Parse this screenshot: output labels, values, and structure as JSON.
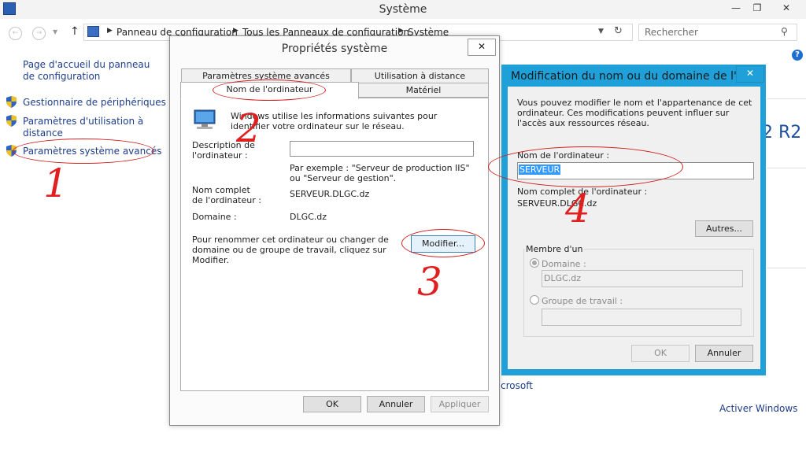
{
  "window": {
    "title": "Système",
    "minimize": "—",
    "restore": "❐",
    "close": "✕"
  },
  "nav": {
    "back": "←",
    "forward": "→",
    "up": "↑",
    "crumbs": [
      "Panneau de configuration",
      "Tous les Panneaux de configuration",
      "Système"
    ],
    "search_placeholder": "Rechercher"
  },
  "sidebar": {
    "home_link": "Page d'accueil du panneau de configuration",
    "items": [
      {
        "label": "Gestionnaire de périphériques"
      },
      {
        "label": "Paramètres d'utilisation à distance"
      },
      {
        "label": "Paramètres système avancés"
      }
    ]
  },
  "background": {
    "edition_fragment": "2 R2",
    "microsoft_fragment": "crosoft",
    "activate": "Activer Windows"
  },
  "dialog1": {
    "title": "Propriétés système",
    "close": "✕",
    "tabs": [
      "Paramètres système avancés",
      "Utilisation à distance",
      "Nom de l'ordinateur",
      "Matériel"
    ],
    "intro": "Windows utilise les informations suivantes pour identifier votre ordinateur sur le réseau.",
    "description_label": "Description de l'ordinateur :",
    "description_value": "",
    "example": "Par exemple : \"Serveur de production IIS\" ou \"Serveur de gestion\".",
    "fullname_label": "Nom complet de l'ordinateur :",
    "fullname_value": "SERVEUR.DLGC.dz",
    "domain_label": "Domaine :",
    "domain_value": "DLGC.dz",
    "rename_text": "Pour renommer cet ordinateur ou changer de domaine ou de groupe de travail, cliquez sur Modifier.",
    "modify_button": "Modifier...",
    "ok": "OK",
    "cancel": "Annuler",
    "apply": "Appliquer"
  },
  "dialog2": {
    "title": "Modification du nom ou du domaine de l'...",
    "close": "✕",
    "intro": "Vous pouvez modifier le nom et l'appartenance de cet ordinateur. Ces modifications peuvent influer sur l'accès aux ressources réseau.",
    "computer_name_label": "Nom de l'ordinateur :",
    "computer_name_value": "SERVEUR",
    "fullname_label": "Nom complet de l'ordinateur :",
    "fullname_value": "SERVEUR.DLGC.dz",
    "others_button": "Autres...",
    "member_of": "Membre d'un",
    "domain_radio": "Domaine :",
    "domain_value": "DLGC.dz",
    "workgroup_radio": "Groupe de travail :",
    "workgroup_value": "",
    "ok": "OK",
    "cancel": "Annuler"
  },
  "annotations": [
    "1",
    "2",
    "3",
    "4"
  ],
  "colors": {
    "accent_title": "#1fa0d9",
    "annotation_red": "#e02020",
    "link_blue": "#1e3e8a"
  }
}
